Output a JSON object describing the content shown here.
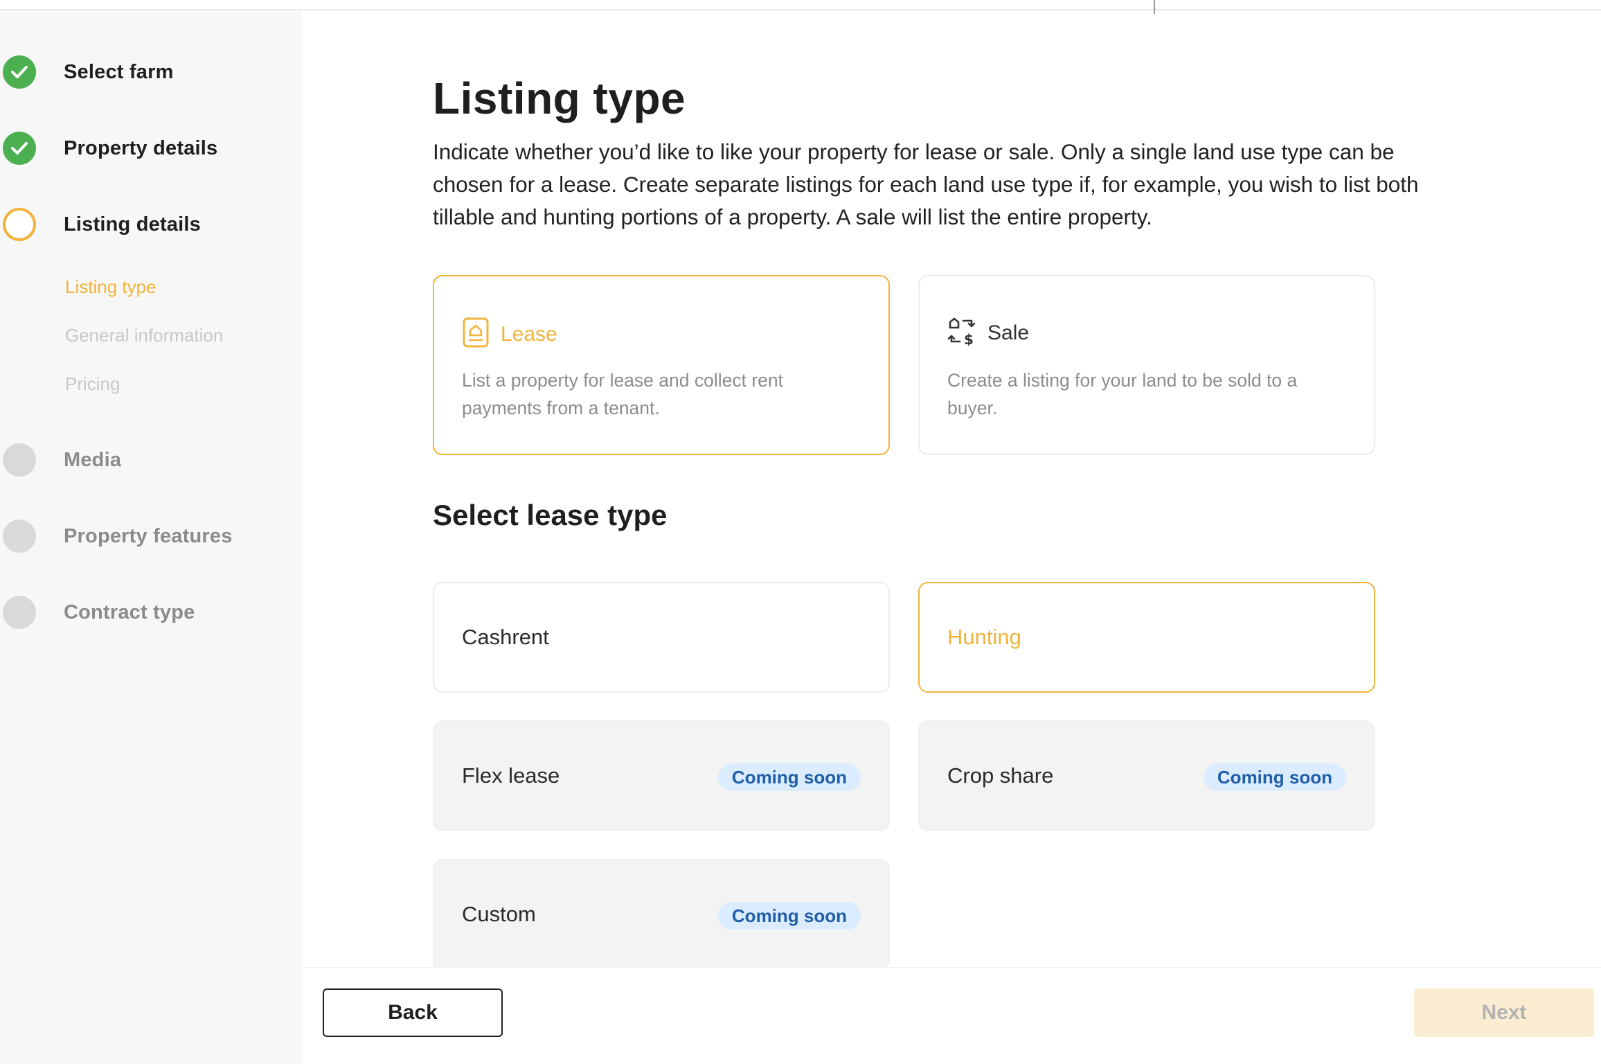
{
  "sidebar": {
    "steps": [
      {
        "label": "Select farm",
        "status": "done"
      },
      {
        "label": "Property details",
        "status": "done"
      },
      {
        "label": "Listing details",
        "status": "current"
      },
      {
        "label": "Media",
        "status": "todo"
      },
      {
        "label": "Property features",
        "status": "todo"
      },
      {
        "label": "Contract type",
        "status": "todo"
      }
    ],
    "substeps": [
      {
        "label": "Listing type",
        "status": "active"
      },
      {
        "label": "General information",
        "status": "inactive"
      },
      {
        "label": "Pricing",
        "status": "inactive"
      }
    ]
  },
  "main": {
    "title": "Listing type",
    "description": "Indicate whether you’d like to like your property for lease or sale. Only a single land use type can be chosen for a lease. Create separate listings for each land use type if, for example, you wish to list both tillable and hunting portions of a property. A sale will list the entire property.",
    "listing_options": [
      {
        "title": "Lease",
        "description": "List a property for lease and collect rent payments from a tenant.",
        "icon": "document-house-icon",
        "selected": true
      },
      {
        "title": "Sale",
        "description": "Create a listing for your land to be sold to a buyer.",
        "icon": "exchange-dollar-icon",
        "selected": false
      }
    ],
    "lease_section_title": "Select lease type",
    "lease_types": [
      {
        "label": "Cashrent",
        "state": "default"
      },
      {
        "label": "Hunting",
        "state": "selected"
      },
      {
        "label": "Flex lease",
        "state": "disabled",
        "badge": "Coming soon"
      },
      {
        "label": "Crop share",
        "state": "disabled",
        "badge": "Coming soon"
      },
      {
        "label": "Custom",
        "state": "disabled",
        "badge": "Coming soon"
      }
    ]
  },
  "footer": {
    "back_label": "Back",
    "next_label": "Next"
  },
  "colors": {
    "accent": "#f2b33d",
    "done": "#4caf50",
    "badge_bg": "#dcecff",
    "badge_text": "#1f5ea8"
  }
}
